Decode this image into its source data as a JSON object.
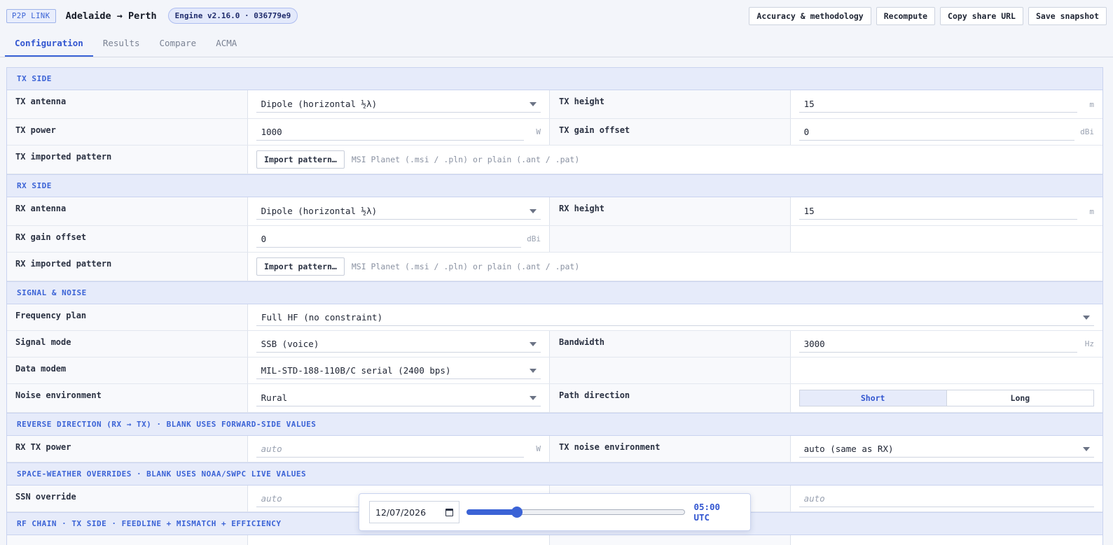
{
  "header": {
    "badge": "P2P LINK",
    "route": "Adelaide → Perth",
    "engine": "Engine v2.16.0 · 036779e9",
    "actions": [
      "Accuracy & methodology",
      "Recompute",
      "Copy share URL",
      "Save snapshot"
    ]
  },
  "tabs": [
    "Configuration",
    "Results",
    "Compare",
    "ACMA"
  ],
  "active_tab": "Configuration",
  "tx": {
    "section": "TX SIDE",
    "antenna_label": "TX antenna",
    "antenna": "Dipole (horizontal ½λ)",
    "height_label": "TX height",
    "height": "15",
    "height_unit": "m",
    "power_label": "TX power",
    "power": "1000",
    "power_unit": "W",
    "gain_label": "TX gain offset",
    "gain": "0",
    "gain_unit": "dBi",
    "pattern_label": "TX imported pattern",
    "import_btn": "Import pattern…",
    "pattern_hint": "MSI Planet (.msi / .pln) or plain (.ant / .pat)"
  },
  "rx": {
    "section": "RX SIDE",
    "antenna_label": "RX antenna",
    "antenna": "Dipole (horizontal ½λ)",
    "height_label": "RX height",
    "height": "15",
    "height_unit": "m",
    "gain_label": "RX gain offset",
    "gain": "0",
    "gain_unit": "dBi",
    "pattern_label": "RX imported pattern",
    "import_btn": "Import pattern…",
    "pattern_hint": "MSI Planet (.msi / .pln) or plain (.ant / .pat)"
  },
  "signal": {
    "section": "SIGNAL & NOISE",
    "freq_label": "Frequency plan",
    "freq": "Full HF (no constraint)",
    "mode_label": "Signal mode",
    "mode": "SSB (voice)",
    "bw_label": "Bandwidth",
    "bw": "3000",
    "bw_unit": "Hz",
    "modem_label": "Data modem",
    "modem": "MIL-STD-188-110B/C serial (2400 bps)",
    "noise_label": "Noise environment",
    "noise": "Rural",
    "path_label": "Path direction",
    "path_options": [
      "Short",
      "Long"
    ],
    "path_selected": "Short"
  },
  "reverse": {
    "section": "REVERSE DIRECTION (RX → TX) · BLANK USES FORWARD-SIDE VALUES",
    "power_label": "RX TX power",
    "power_placeholder": "auto",
    "power_unit": "W",
    "noise_label": "TX noise environment",
    "noise": "auto (same as RX)"
  },
  "weather": {
    "section": "SPACE-WEATHER OVERRIDES · BLANK USES NOAA/SWPC LIVE VALUES",
    "ssn_label": "SSN override",
    "ssn_placeholder": "auto",
    "other_placeholder": "auto"
  },
  "rfchain": {
    "section": "RF CHAIN · TX SIDE · FEEDLINE + MISMATCH + EFFICIENCY"
  },
  "timebar": {
    "date": "12/07/2026",
    "time": "05:00 UTC",
    "slider_fraction": 0.23
  }
}
